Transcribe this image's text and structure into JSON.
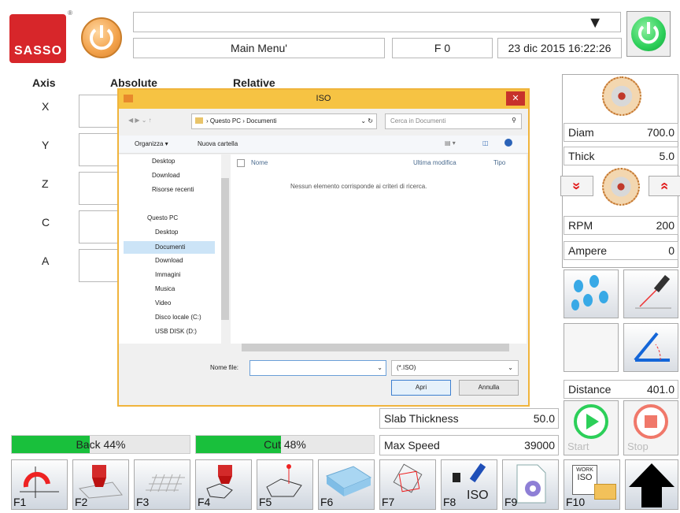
{
  "brand": {
    "logo_text": "SASSO",
    "reg": "®"
  },
  "header": {
    "menu_title": "Main Menu'",
    "f_label": "F 0",
    "datetime": "23 dic 2015 16:22:26",
    "dropdown_arrow": "▼"
  },
  "axes": {
    "col_axis": "Axis",
    "col_absolute": "Absolute",
    "col_relative": "Relative",
    "rows": [
      "X",
      "Y",
      "Z",
      "C",
      "A"
    ]
  },
  "right": {
    "diam_label": "Diam",
    "diam_value": "700.0",
    "thick_label": "Thick",
    "thick_value": "5.0",
    "rpm_label": "RPM",
    "rpm_value": "200",
    "ampere_label": "Ampere",
    "ampere_value": "0",
    "distance_label": "Distance",
    "distance_value": "401.0",
    "chev_down": "»",
    "chev_up": "«"
  },
  "params": {
    "slab_label": "Slab Thickness",
    "slab_value": "50.0",
    "speed_label": "Max Speed",
    "speed_value": "39000",
    "start_label": "Start",
    "stop_label": "Stop"
  },
  "progress": {
    "back_text": "Back 44%",
    "back_value": 0.44,
    "cut_text": "Cut 48%",
    "cut_value": 0.48
  },
  "fkeys": [
    "F1",
    "F2",
    "F3",
    "F4",
    "F5",
    "F6",
    "F7",
    "F8",
    "F9",
    "F10"
  ],
  "fkey_extra": {
    "f8_iso": "ISO",
    "f10_work": "WORK",
    "f10_iso": "ISO"
  },
  "dialog": {
    "title": "ISO",
    "close": "✕",
    "breadcrumb": "› Questo PC › Documenti",
    "search_placeholder": "Cerca in Documenti",
    "organize": "Organizza ▾",
    "new_folder": "Nuova cartella",
    "col_name": "Nome",
    "col_modified": "Ultima modifica",
    "col_type": "Tipo",
    "empty_msg": "Nessun elemento corrisponde ai criteri di ricerca.",
    "nav_items": [
      "Desktop",
      "Download",
      "Risorse recenti",
      "Questo PC",
      "Desktop",
      "Documenti",
      "Download",
      "Immagini",
      "Musica",
      "Video",
      "Disco locale (C:)",
      "USB DISK (D:)"
    ],
    "filename_label": "Nome file:",
    "filter": "(*.ISO)",
    "open_button": "Apri",
    "cancel_button": "Annulla"
  },
  "colors": {
    "green": "#19c03c",
    "brand_red": "#d7262a",
    "dialog_border": "#f0b43c"
  }
}
